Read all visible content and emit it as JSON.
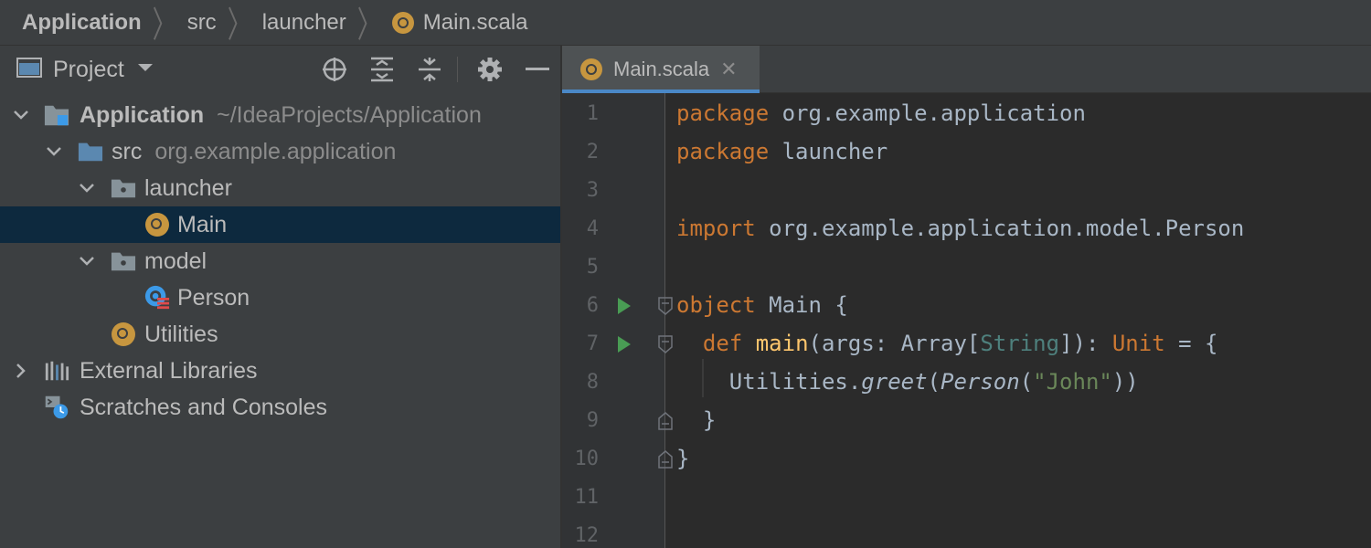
{
  "breadcrumb": {
    "items": [
      "Application",
      "src",
      "launcher",
      "Main.scala"
    ]
  },
  "project_panel": {
    "title": "Project",
    "tools": [
      "locate-icon",
      "expand-all-icon",
      "collapse-all-icon",
      "gear-icon",
      "minimize-icon"
    ],
    "tree": [
      {
        "label": "Application",
        "hint": "~/IdeaProjects/Application",
        "icon": "project-folder-icon",
        "expanded": true,
        "bold": true
      },
      {
        "label": "src",
        "hint": "org.example.application",
        "icon": "source-folder-icon",
        "expanded": true
      },
      {
        "label": "launcher",
        "hint": "",
        "icon": "package-icon",
        "expanded": true
      },
      {
        "label": "Main",
        "hint": "",
        "icon": "scala-object-icon",
        "selected": true
      },
      {
        "label": "model",
        "hint": "",
        "icon": "package-icon",
        "expanded": true
      },
      {
        "label": "Person",
        "hint": "",
        "icon": "scala-case-class-icon"
      },
      {
        "label": "Utilities",
        "hint": "",
        "icon": "scala-object-icon"
      },
      {
        "label": "External Libraries",
        "hint": "",
        "icon": "libraries-icon",
        "expanded": false
      },
      {
        "label": "Scratches and Consoles",
        "hint": "",
        "icon": "scratches-icon"
      }
    ]
  },
  "editor": {
    "tab": {
      "label": "Main.scala",
      "close": "✕"
    },
    "line_numbers": [
      "1",
      "2",
      "3",
      "4",
      "5",
      "6",
      "7",
      "8",
      "9",
      "10",
      "11",
      "12"
    ],
    "code": {
      "l1": {
        "kw": "package",
        "rest": " org.example.application"
      },
      "l2": {
        "kw": "package",
        "rest": " launcher"
      },
      "l4": {
        "kw": "import",
        "rest": " org.example.application.model.Person"
      },
      "l6": {
        "kw": "object",
        "rest": " Main {"
      },
      "l7": {
        "indent": "  ",
        "kw": "def",
        "sp": " ",
        "fn": "main",
        "a": "(args: Array[",
        "ty": "String",
        "b": "]): ",
        "kw2": "Unit",
        "c": " = {"
      },
      "l8": {
        "indent": "    ",
        "a": "Utilities.",
        "it1": "greet",
        "b": "(",
        "it2": "Person",
        "c": "(",
        "str": "\"John\"",
        "d": "))"
      },
      "l9": {
        "text": "  }"
      },
      "l10": {
        "text": "}"
      }
    }
  },
  "colors": {
    "keyword": "#cc7832",
    "function": "#ffc66d",
    "string": "#6a8759",
    "type_param": "#4e807d",
    "selection": "#0d293e",
    "run_gutter": "#499c54",
    "accent": "#4a88c7"
  }
}
